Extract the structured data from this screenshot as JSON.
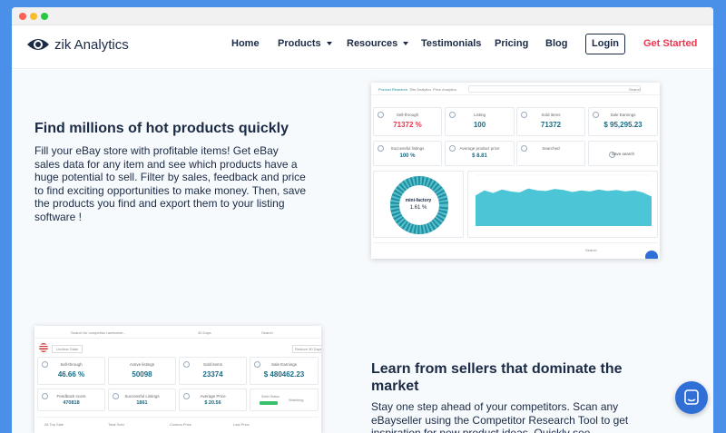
{
  "nav": {
    "brand": "zik Analytics",
    "items": [
      "Home",
      "Products",
      "Resources",
      "Testimonials",
      "Pricing",
      "Blog"
    ],
    "login": "Login",
    "get_started": "Get Started"
  },
  "section1": {
    "title": "Find millions of hot products quickly",
    "body": "Fill your eBay store with profitable items! Get eBay sales data for any item and see which products have a huge potential to sell. Filter by sales, feedback and price to find exciting opportunities to make money. Then, save the products you find and export them to your listing software !"
  },
  "dash1": {
    "tabs": [
      "Product Research",
      "Title Analytics",
      "Price Analytics"
    ],
    "search_button": "Search",
    "tiles": [
      {
        "label": "Sell-through",
        "value": "71372 %"
      },
      {
        "label": "Listing",
        "value": "100"
      },
      {
        "label": "Sold items",
        "value": "71372"
      },
      {
        "label": "Sale Earnings",
        "value": "$ 95,295.23"
      },
      {
        "label": "Successful listings",
        "value": "100 %"
      },
      {
        "label": "Average product price",
        "value": "$ 8.81"
      },
      {
        "label": "Searched",
        "value": ""
      },
      {
        "label": "",
        "value": "Save search"
      }
    ],
    "donut_title": "mini-factory",
    "donut_value": "1.61 %",
    "bottom_search": "Search",
    "chart_series": [
      60,
      70,
      65,
      72,
      68,
      66,
      74,
      70,
      69,
      73,
      71,
      67,
      70,
      68,
      72,
      69,
      71,
      68,
      70,
      66,
      58
    ],
    "colors": {
      "accent": "#1e8fa0",
      "chart_fill": "#4cc6d6",
      "value": "#1b6b84"
    }
  },
  "section2": {
    "title": "Learn from sellers that dominate the market",
    "body": "Stay one step ahead of your competitors. Scan any eBayseller using the Competitor Research Tool to get inspiration for new product ideas. Quickly see"
  },
  "dash2": {
    "search_placeholder": "Search for competitor username...",
    "period": "30 Days",
    "search_button": "Search",
    "seller_name": "Unclear State",
    "restore_label": "Restore 30 Days",
    "tiles": [
      {
        "label": "Sell-through",
        "value": "46.66 %"
      },
      {
        "label": "Active listings",
        "value": "50098"
      },
      {
        "label": "Sold items",
        "value": "23374"
      },
      {
        "label": "Sale Earnings",
        "value": "$ 480462.23"
      },
      {
        "label": "Feedback score",
        "value": "470818"
      },
      {
        "label": "Successful Listings",
        "value": "1861"
      },
      {
        "label": "Average Price",
        "value": "$ 20.56"
      },
      {
        "label": "Seller Status",
        "value": "Watching"
      }
    ],
    "bottom_tabs": [
      "All Top Sale",
      "Total Sold",
      "Custom Price",
      "Last Price"
    ]
  }
}
